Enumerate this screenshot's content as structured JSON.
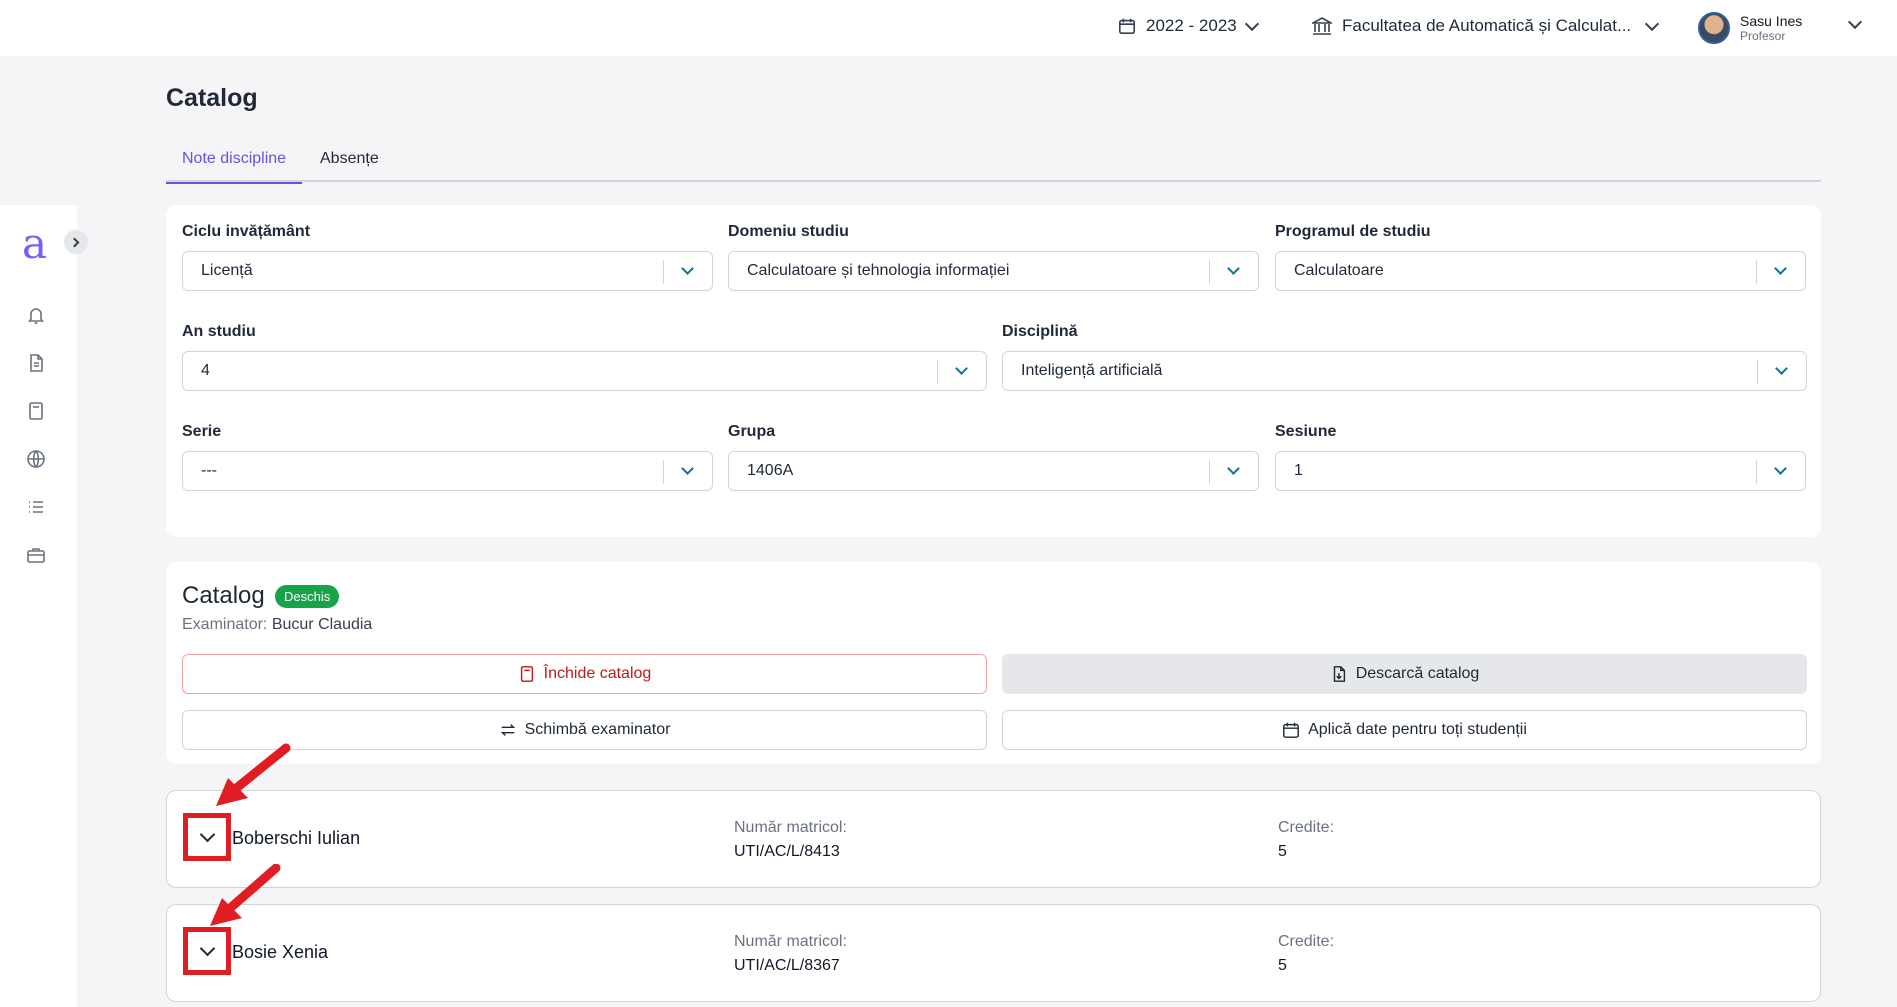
{
  "topbar": {
    "year": "2022 - 2023",
    "faculty": "Facultatea de Automatică și Calculat...",
    "user_name": "Sasu Ines",
    "user_role": "Profesor"
  },
  "sidebar": {
    "logo": "a",
    "icons": [
      "bell-icon",
      "document-icon",
      "book-icon",
      "globe-icon",
      "list-icon",
      "briefcase-icon"
    ]
  },
  "page": {
    "title": "Catalog",
    "tabs": [
      {
        "label": "Note discipline",
        "active": true
      },
      {
        "label": "Absențe",
        "active": false
      }
    ]
  },
  "filters": {
    "ciclu": {
      "label": "Ciclu invățământ",
      "value": "Licență"
    },
    "domeniu": {
      "label": "Domeniu studiu",
      "value": "Calculatoare și tehnologia informației"
    },
    "program": {
      "label": "Programul de studiu",
      "value": "Calculatoare"
    },
    "an": {
      "label": "An studiu",
      "value": "4"
    },
    "disciplina": {
      "label": "Disciplină",
      "value": "Inteligență artificială"
    },
    "serie": {
      "label": "Serie",
      "value": "---"
    },
    "grupa": {
      "label": "Grupa",
      "value": "1406A"
    },
    "sesiune": {
      "label": "Sesiune",
      "value": "1"
    }
  },
  "catalog": {
    "title": "Catalog",
    "status": "Deschis",
    "examinator_label": "Examinator:",
    "examinator": "Bucur Claudia",
    "buttons": {
      "close": "Închide catalog",
      "download": "Descarcă catalog",
      "change": "Schimbă examinator",
      "apply": "Aplică date pentru toți studenții"
    }
  },
  "students": [
    {
      "name": "Boberschi Iulian",
      "matricol_label": "Număr matricol:",
      "matricol": "UTI/AC/L/8413",
      "credite_label": "Credite:",
      "credite": "5"
    },
    {
      "name": "Bosie Xenia",
      "matricol_label": "Număr matricol:",
      "matricol": "UTI/AC/L/8367",
      "credite_label": "Credite:",
      "credite": "5"
    }
  ],
  "colors": {
    "accent": "#6d4fe0",
    "danger": "#e11d24",
    "success": "#16a34a"
  }
}
